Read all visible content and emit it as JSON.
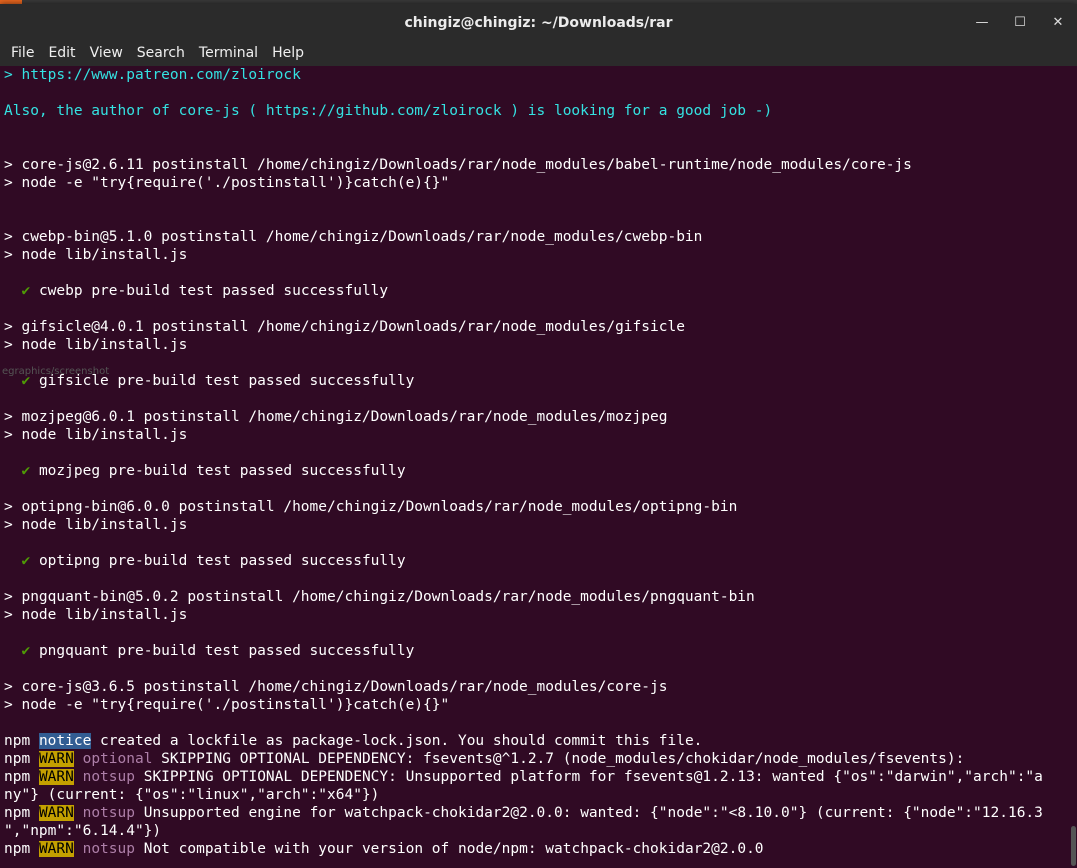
{
  "window": {
    "title": "chingiz@chingiz: ~/Downloads/rar",
    "minimize": "—",
    "maximize": "☐",
    "close": "✕"
  },
  "menu": [
    "File",
    "Edit",
    "View",
    "Search",
    "Terminal",
    "Help"
  ],
  "ghost_text": "egraphics/screenshot",
  "terminal": {
    "l01": "> https://www.patreon.com/zloirock",
    "l03": "Also, the author of core-js ( https://github.com/zloirock ) is looking for a good job -)",
    "l06": "> core-js@2.6.11 postinstall /home/chingiz/Downloads/rar/node_modules/babel-runtime/node_modules/core-js",
    "l07": "> node -e \"try{require('./postinstall')}catch(e){}\"",
    "l10": "> cwebp-bin@5.1.0 postinstall /home/chingiz/Downloads/rar/node_modules/cwebp-bin",
    "l11": "> node lib/install.js",
    "check": "✔",
    "l13": "cwebp pre-build test passed successfully",
    "l15": "> gifsicle@4.0.1 postinstall /home/chingiz/Downloads/rar/node_modules/gifsicle",
    "l16": "> node lib/install.js",
    "l18": "gifsicle pre-build test passed successfully",
    "l20": "> mozjpeg@6.0.1 postinstall /home/chingiz/Downloads/rar/node_modules/mozjpeg",
    "l21": "> node lib/install.js",
    "l23": "mozjpeg pre-build test passed successfully",
    "l25": "> optipng-bin@6.0.0 postinstall /home/chingiz/Downloads/rar/node_modules/optipng-bin",
    "l26": "> node lib/install.js",
    "l28": "optipng pre-build test passed successfully",
    "l30": "> pngquant-bin@5.0.2 postinstall /home/chingiz/Downloads/rar/node_modules/pngquant-bin",
    "l31": "> node lib/install.js",
    "l33": "pngquant pre-build test passed successfully",
    "l35": "> core-js@3.6.5 postinstall /home/chingiz/Downloads/rar/node_modules/core-js",
    "l36": "> node -e \"try{require('./postinstall')}catch(e){}\"",
    "npm": "npm",
    "notice": "notice",
    "warn": "WARN",
    "optional": "optional",
    "notsup": "notsup",
    "l38": " created a lockfile as package-lock.json. You should commit this file.",
    "l39": " SKIPPING OPTIONAL DEPENDENCY: fsevents@^1.2.7 (node_modules/chokidar/node_modules/fsevents):",
    "l40": " SKIPPING OPTIONAL DEPENDENCY: Unsupported platform for fsevents@1.2.13: wanted {\"os\":\"darwin\",\"arch\":\"a",
    "l41": "ny\"} (current: {\"os\":\"linux\",\"arch\":\"x64\"})",
    "l42": " Unsupported engine for watchpack-chokidar2@2.0.0: wanted: {\"node\":\"<8.10.0\"} (current: {\"node\":\"12.16.3",
    "l43": "\",\"npm\":\"6.14.4\"})",
    "l44": " Not compatible with your version of node/npm: watchpack-chokidar2@2.0.0"
  }
}
